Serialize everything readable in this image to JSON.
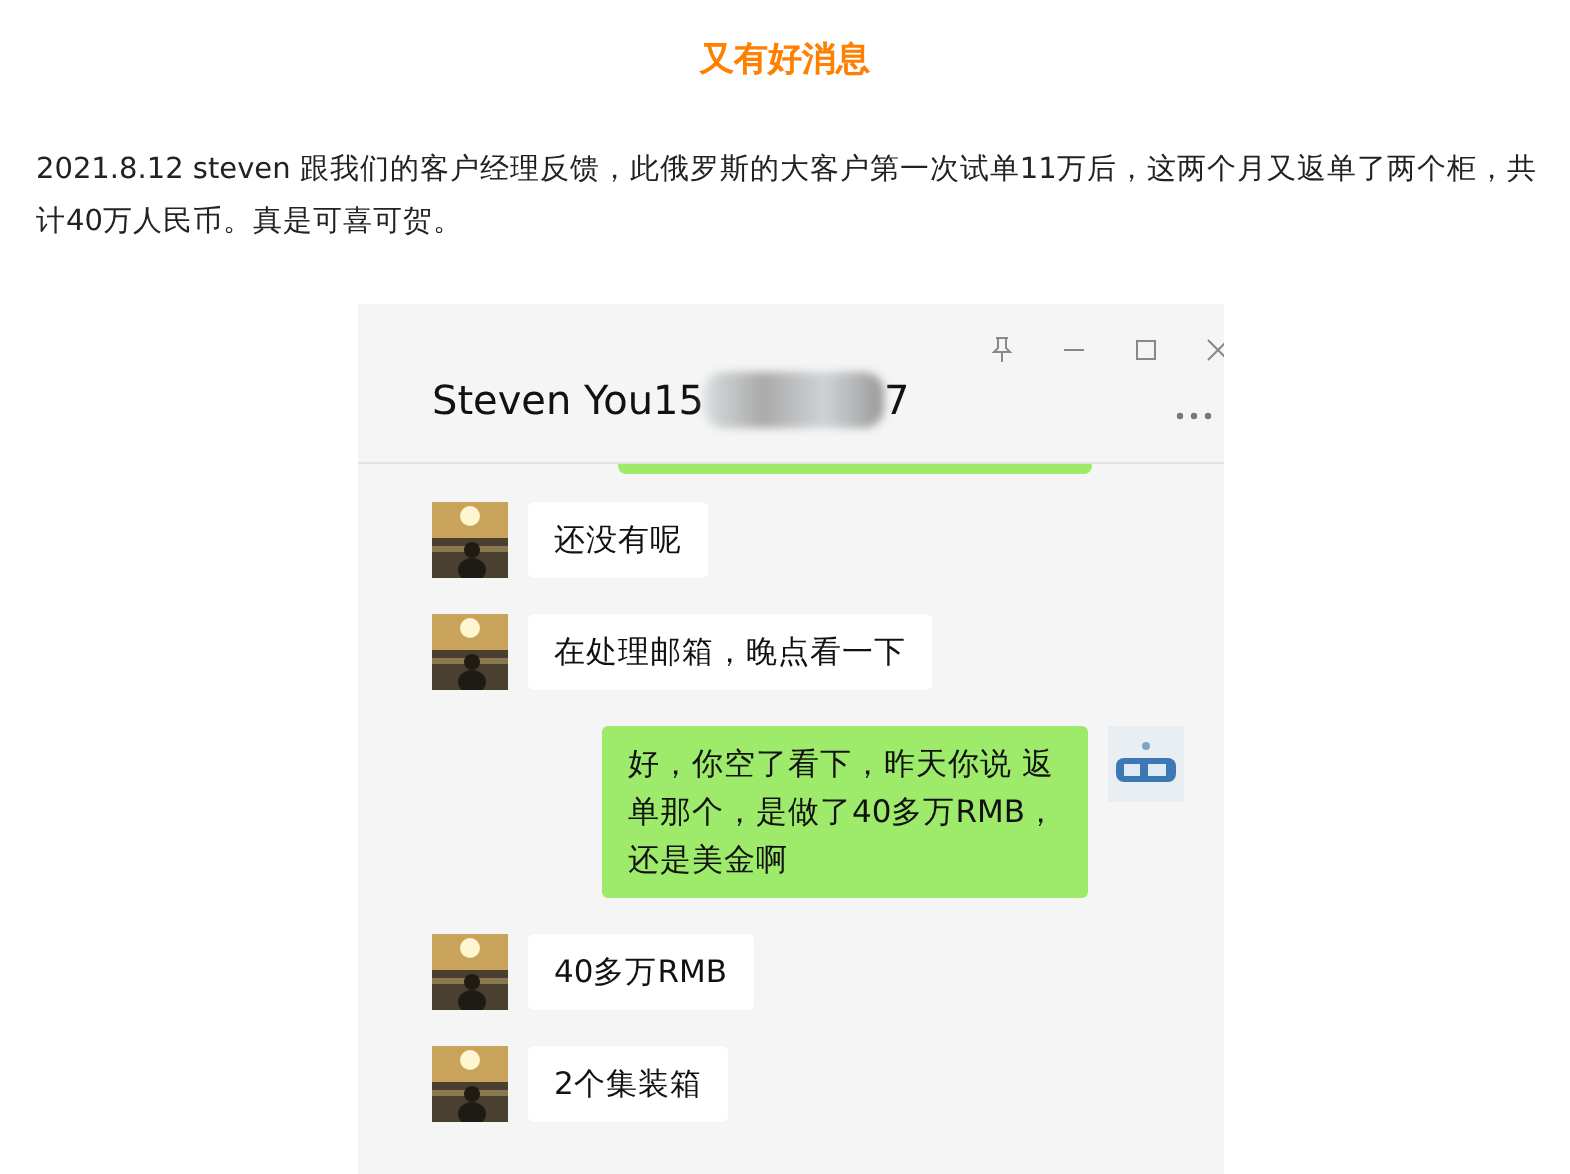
{
  "article": {
    "title": "又有好消息",
    "paragraph": "2021.8.12  steven 跟我们的客户经理反馈，此俄罗斯的大客户第一次试单11万后，这两个月又返单了两个柜，共计40万人民币。真是可喜可贺。"
  },
  "chat": {
    "title": "Steven You15",
    "title_tail": "7",
    "messages": [
      {
        "kind": "received",
        "text": "还没有呢"
      },
      {
        "kind": "received",
        "text": "在处理邮箱，晚点看一下"
      },
      {
        "kind": "sent",
        "text": "好，你空了看下，昨天你说 返单那个，是做了40多万RMB，还是美金啊"
      },
      {
        "kind": "received",
        "text": "40多万RMB"
      },
      {
        "kind": "received",
        "text": "2个集装箱"
      }
    ]
  }
}
